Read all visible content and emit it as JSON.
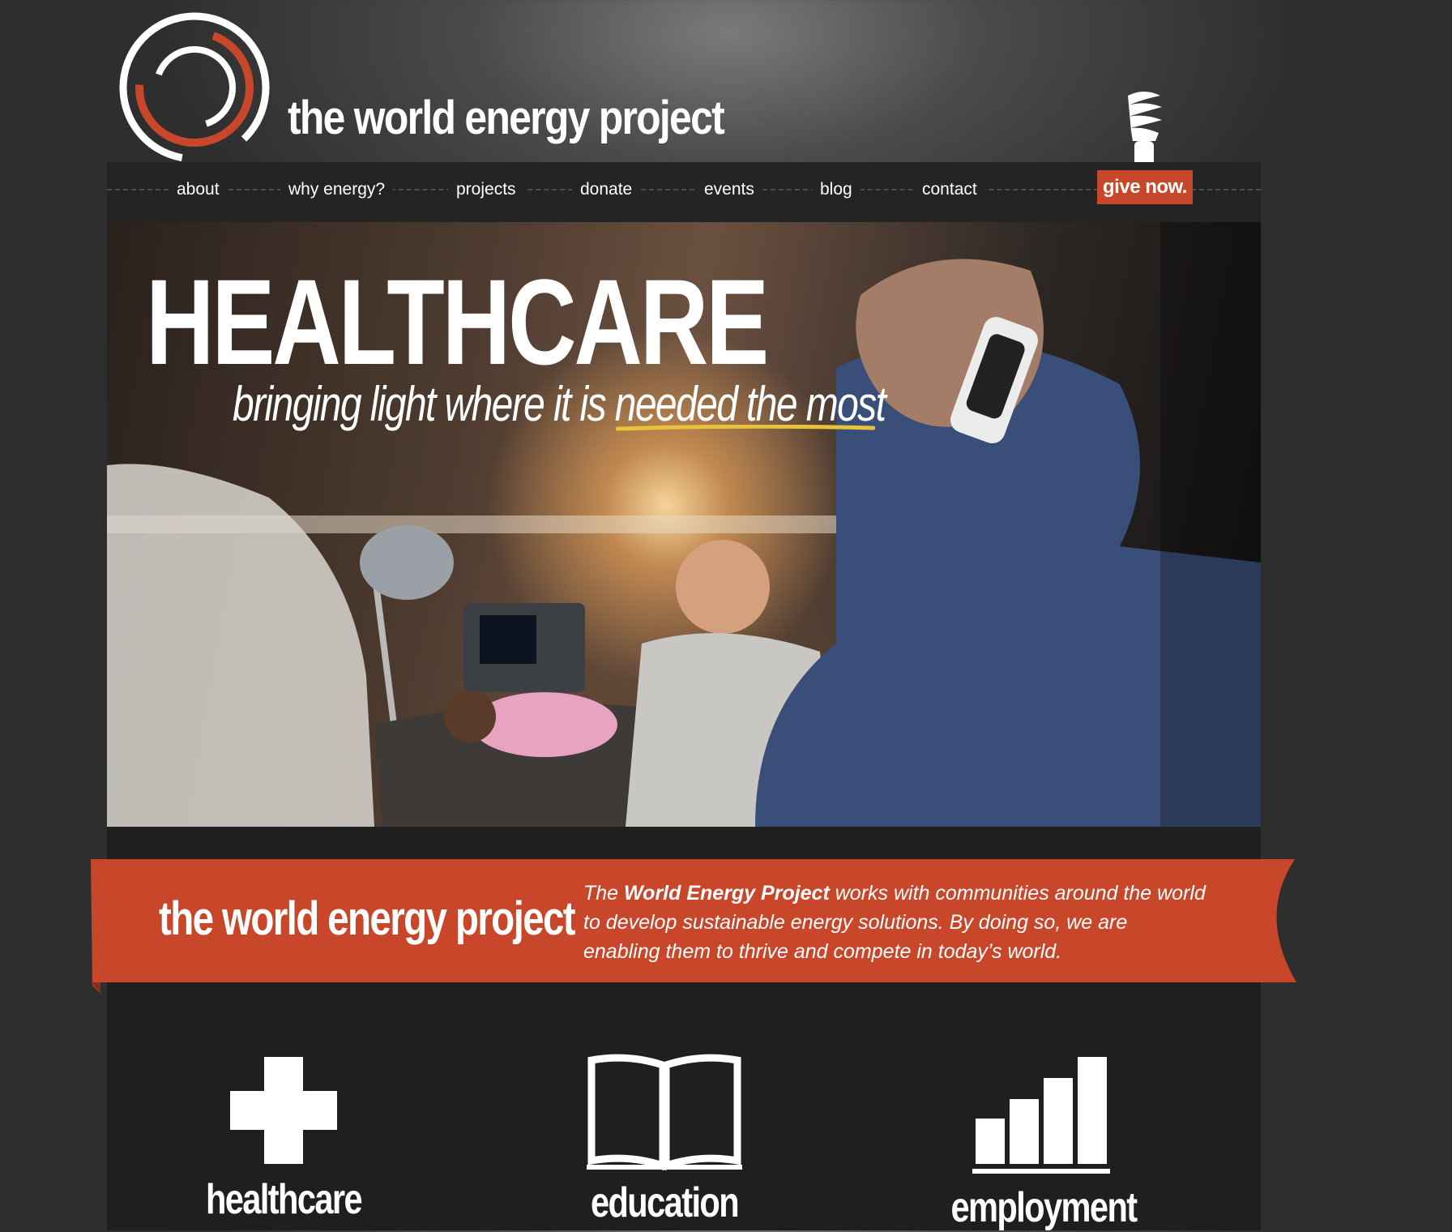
{
  "header": {
    "title": "the world energy project",
    "give_label": "give now."
  },
  "nav": {
    "items": [
      "about",
      "why energy?",
      "projects",
      "donate",
      "events",
      "blog",
      "contact"
    ]
  },
  "hero": {
    "title": "HEALTHCARE",
    "subtitle": "bringing light where it is needed the most"
  },
  "banner": {
    "title": "the world energy project",
    "desc_pre": "The ",
    "desc_bold": "World Energy Project",
    "desc_post": " works with communities around the world to develop sustainable energy solutions. By doing so, we are enabling them to thrive and compete in today’s world."
  },
  "features": [
    {
      "label": "healthcare",
      "icon": "plus-icon"
    },
    {
      "label": "education",
      "icon": "book-icon"
    },
    {
      "label": "employment",
      "icon": "bar-chart-icon"
    }
  ],
  "colors": {
    "accent": "#c8472b",
    "highlight": "#e8c33a",
    "background": "#2f2f2f"
  }
}
